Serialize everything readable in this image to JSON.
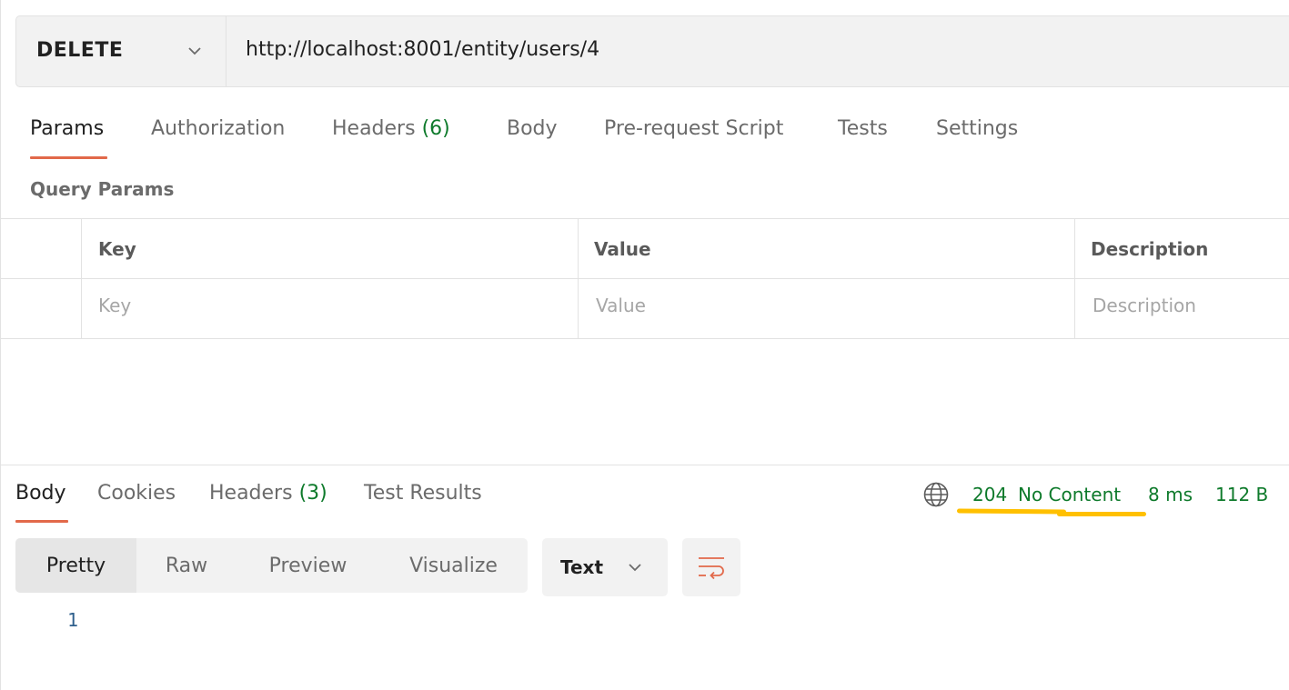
{
  "request": {
    "method": "DELETE",
    "url": "http://localhost:8001/entity/users/4"
  },
  "request_tabs": [
    {
      "label": "Params",
      "active": true
    },
    {
      "label": "Authorization"
    },
    {
      "label": "Headers",
      "count": "(6)"
    },
    {
      "label": "Body"
    },
    {
      "label": "Pre-request Script"
    },
    {
      "label": "Tests"
    },
    {
      "label": "Settings"
    }
  ],
  "query_params": {
    "title": "Query Params",
    "columns": [
      "Key",
      "Value",
      "Description"
    ],
    "placeholders": [
      "Key",
      "Value",
      "Description"
    ]
  },
  "response_tabs": [
    {
      "label": "Body",
      "active": true
    },
    {
      "label": "Cookies"
    },
    {
      "label": "Headers",
      "count": "(3)"
    },
    {
      "label": "Test Results"
    }
  ],
  "response_meta": {
    "globe_icon": "globe-icon",
    "status_code": "204",
    "status_text": "No Content",
    "time": "8 ms",
    "size": "112 B",
    "status_color": "#0e7a2b",
    "highlight_color": "#ffc000"
  },
  "view_modes": [
    "Pretty",
    "Raw",
    "Preview",
    "Visualize"
  ],
  "format": "Text",
  "wrap_icon": "wrap-lines-icon",
  "body_lines": [
    "1"
  ],
  "accent_color": "#e2694a"
}
